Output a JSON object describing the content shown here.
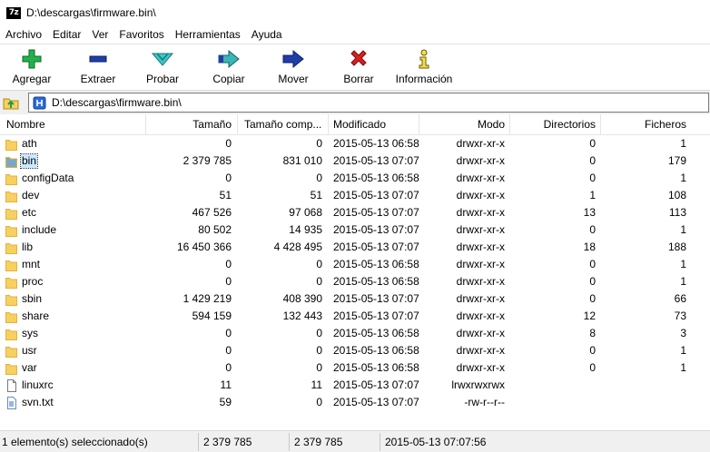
{
  "window": {
    "title": "D:\\descargas\\firmware.bin\\",
    "app_icon_text": "7z"
  },
  "menu": [
    "Archivo",
    "Editar",
    "Ver",
    "Favoritos",
    "Herramientas",
    "Ayuda"
  ],
  "toolbar": {
    "add": "Agregar",
    "extract": "Extraer",
    "test": "Probar",
    "copy": "Copiar",
    "move": "Mover",
    "delete": "Borrar",
    "info": "Información"
  },
  "address": {
    "path": "D:\\descargas\\firmware.bin\\"
  },
  "columns": {
    "name": "Nombre",
    "size": "Tamaño",
    "packed": "Tamaño comp...",
    "modified": "Modificado",
    "mode": "Modo",
    "folders": "Directorios",
    "files": "Ficheros"
  },
  "rows": [
    {
      "name": "ath",
      "type": "folder",
      "size": "0",
      "packed": "0",
      "modified": "2015-05-13 06:58",
      "mode": "drwxr-xr-x",
      "folders": "0",
      "files": "1"
    },
    {
      "name": "bin",
      "type": "folder",
      "selected": true,
      "size": "2 379 785",
      "packed": "831 010",
      "modified": "2015-05-13 07:07",
      "mode": "drwxr-xr-x",
      "folders": "0",
      "files": "179"
    },
    {
      "name": "configData",
      "type": "folder",
      "size": "0",
      "packed": "0",
      "modified": "2015-05-13 06:58",
      "mode": "drwxr-xr-x",
      "folders": "0",
      "files": "1"
    },
    {
      "name": "dev",
      "type": "folder",
      "size": "51",
      "packed": "51",
      "modified": "2015-05-13 07:07",
      "mode": "drwxr-xr-x",
      "folders": "1",
      "files": "108"
    },
    {
      "name": "etc",
      "type": "folder",
      "size": "467 526",
      "packed": "97 068",
      "modified": "2015-05-13 07:07",
      "mode": "drwxr-xr-x",
      "folders": "13",
      "files": "113"
    },
    {
      "name": "include",
      "type": "folder",
      "size": "80 502",
      "packed": "14 935",
      "modified": "2015-05-13 07:07",
      "mode": "drwxr-xr-x",
      "folders": "0",
      "files": "1"
    },
    {
      "name": "lib",
      "type": "folder",
      "size": "16 450 366",
      "packed": "4 428 495",
      "modified": "2015-05-13 07:07",
      "mode": "drwxr-xr-x",
      "folders": "18",
      "files": "188"
    },
    {
      "name": "mnt",
      "type": "folder",
      "size": "0",
      "packed": "0",
      "modified": "2015-05-13 06:58",
      "mode": "drwxr-xr-x",
      "folders": "0",
      "files": "1"
    },
    {
      "name": "proc",
      "type": "folder",
      "size": "0",
      "packed": "0",
      "modified": "2015-05-13 06:58",
      "mode": "drwxr-xr-x",
      "folders": "0",
      "files": "1"
    },
    {
      "name": "sbin",
      "type": "folder",
      "size": "1 429 219",
      "packed": "408 390",
      "modified": "2015-05-13 07:07",
      "mode": "drwxr-xr-x",
      "folders": "0",
      "files": "66"
    },
    {
      "name": "share",
      "type": "folder",
      "size": "594 159",
      "packed": "132 443",
      "modified": "2015-05-13 07:07",
      "mode": "drwxr-xr-x",
      "folders": "12",
      "files": "73"
    },
    {
      "name": "sys",
      "type": "folder",
      "size": "0",
      "packed": "0",
      "modified": "2015-05-13 06:58",
      "mode": "drwxr-xr-x",
      "folders": "8",
      "files": "3"
    },
    {
      "name": "usr",
      "type": "folder",
      "size": "0",
      "packed": "0",
      "modified": "2015-05-13 06:58",
      "mode": "drwxr-xr-x",
      "folders": "0",
      "files": "1"
    },
    {
      "name": "var",
      "type": "folder",
      "size": "0",
      "packed": "0",
      "modified": "2015-05-13 06:58",
      "mode": "drwxr-xr-x",
      "folders": "0",
      "files": "1"
    },
    {
      "name": "linuxrc",
      "type": "file",
      "size": "11",
      "packed": "11",
      "modified": "2015-05-13 07:07",
      "mode": "lrwxrwxrwx",
      "folders": "",
      "files": ""
    },
    {
      "name": "svn.txt",
      "type": "text",
      "size": "59",
      "packed": "0",
      "modified": "2015-05-13 07:07",
      "mode": "-rw-r--r--",
      "folders": "",
      "files": ""
    }
  ],
  "status": {
    "selection": "1 elemento(s) seleccionado(s)",
    "size": "2 379 785",
    "packed": "2 379 785",
    "modified": "2015-05-13 07:07:56"
  },
  "colors": {
    "folder": "#f7d060",
    "folder_dark": "#e3b23c",
    "selected_folder": "#7aa7c7",
    "add_green": "#22b14c",
    "extract_blue": "#1f3ea8",
    "test_teal": "#3cc8c8",
    "delete_red": "#d92020",
    "info_yellow": "#f4e04d"
  }
}
